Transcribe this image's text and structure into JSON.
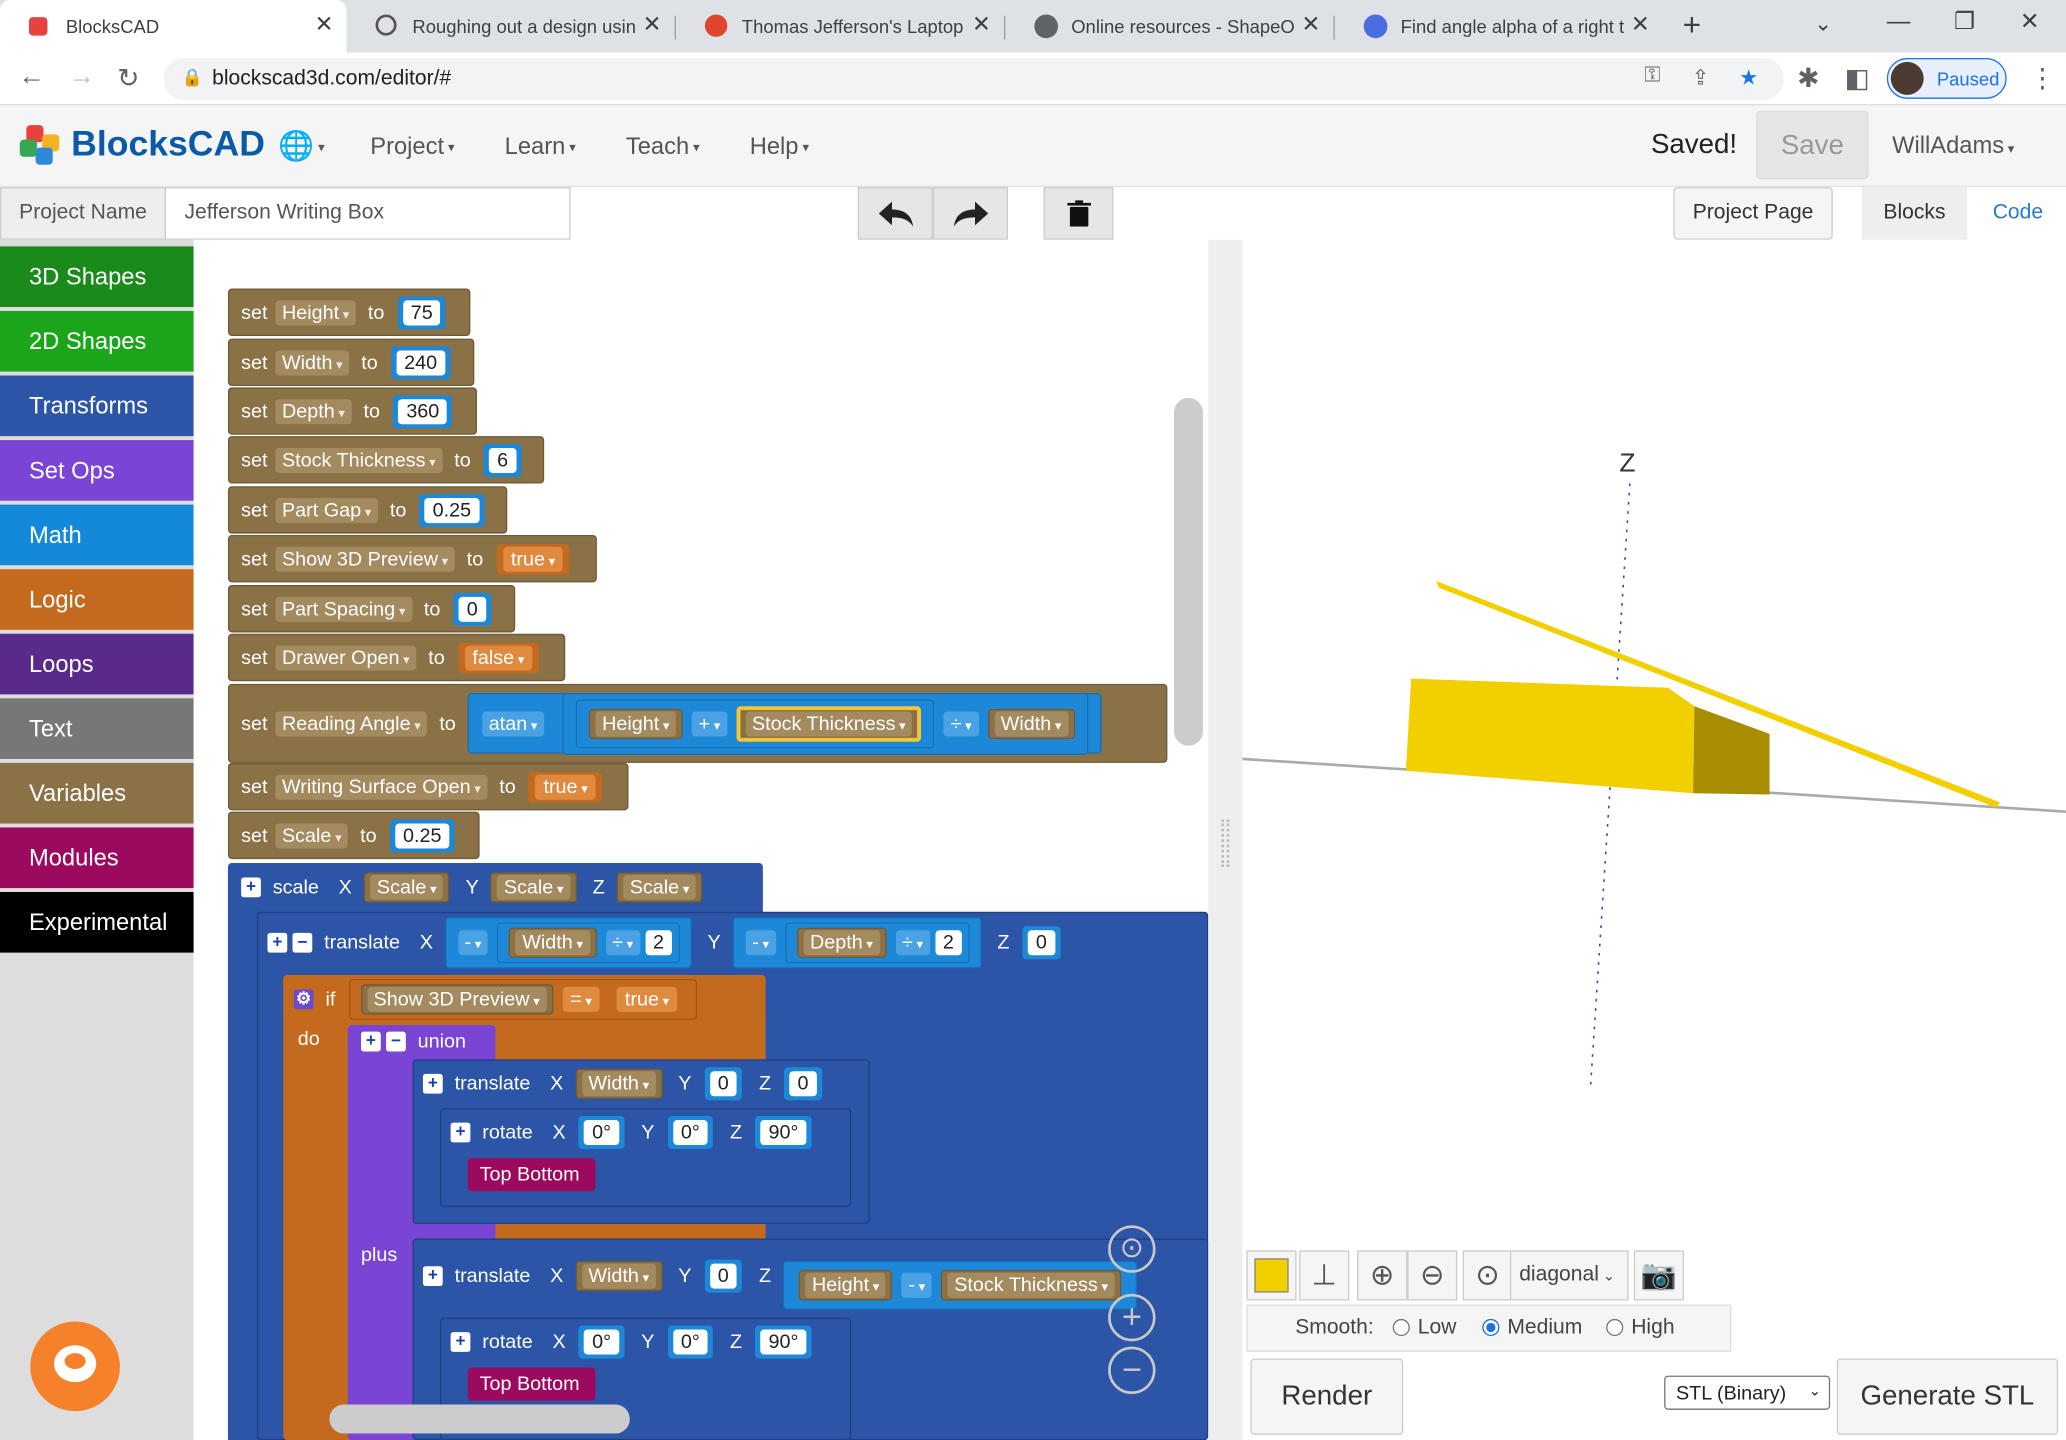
{
  "browser": {
    "tabs": [
      {
        "title": "BlocksCAD",
        "active": true
      },
      {
        "title": "Roughing out a design using",
        "active": false
      },
      {
        "title": "Thomas Jefferson's Laptop W",
        "active": false
      },
      {
        "title": "Online resources - ShapeOko",
        "active": false
      },
      {
        "title": "Find angle alpha of a right tri",
        "active": false
      }
    ],
    "url": "blockscad3d.com/editor/#",
    "profile_status": "Paused"
  },
  "app": {
    "logo_text": "BlocksCAD",
    "menu": [
      "Project",
      "Learn",
      "Teach",
      "Help"
    ],
    "status": "Saved!",
    "save_label": "Save",
    "user": "WillAdams"
  },
  "project": {
    "name_label": "Project Name",
    "name_value": "Jefferson Writing Box",
    "project_page_label": "Project Page",
    "view_tabs": [
      "Blocks",
      "Code"
    ]
  },
  "categories": [
    {
      "label": "3D Shapes",
      "color": "#1a8a1a"
    },
    {
      "label": "2D Shapes",
      "color": "#1aa51a"
    },
    {
      "label": "Transforms",
      "color": "#2c55a7"
    },
    {
      "label": "Set Ops",
      "color": "#7a44d4"
    },
    {
      "label": "Math",
      "color": "#1589d9"
    },
    {
      "label": "Logic",
      "color": "#c46a1f"
    },
    {
      "label": "Loops",
      "color": "#5a2a8a"
    },
    {
      "label": "Text",
      "color": "#777777"
    },
    {
      "label": "Variables",
      "color": "#8b7146"
    },
    {
      "label": "Modules",
      "color": "#9b0a5e"
    },
    {
      "label": "Experimental",
      "color": "#000000"
    }
  ],
  "blocks": {
    "set_kw": "set",
    "to_kw": "to",
    "vars": [
      {
        "name": "Height",
        "value": "75",
        "kind": "num"
      },
      {
        "name": "Width",
        "value": "240",
        "kind": "num"
      },
      {
        "name": "Depth",
        "value": "360",
        "kind": "num"
      },
      {
        "name": "Stock Thickness",
        "value": "6",
        "kind": "num"
      },
      {
        "name": "Part Gap",
        "value": "0.25",
        "kind": "num"
      },
      {
        "name": "Show 3D Preview",
        "value": "true",
        "kind": "bool"
      },
      {
        "name": "Part Spacing",
        "value": "0",
        "kind": "num"
      },
      {
        "name": "Drawer Open",
        "value": "false",
        "kind": "bool"
      }
    ],
    "reading_angle": {
      "name": "Reading Angle",
      "fn": "atan",
      "a": "Height",
      "op1": "+",
      "b": "Stock Thickness",
      "op2": "÷",
      "c": "Width"
    },
    "writing_surface": {
      "name": "Writing Surface Open",
      "value": "true"
    },
    "scale_var": {
      "name": "Scale",
      "value": "0.25"
    },
    "scale_block": {
      "label": "scale",
      "x": "Scale",
      "y": "Scale",
      "z": "Scale"
    },
    "translate1": {
      "label": "translate",
      "xop": "-",
      "xvar": "Width",
      "xdiv": "÷",
      "xnum": "2",
      "yop": "-",
      "yvar": "Depth",
      "ydiv": "÷",
      "ynum": "2",
      "z": "0"
    },
    "if_block": {
      "if": "if",
      "do": "do",
      "var": "Show 3D Preview",
      "op": "=",
      "val": "true"
    },
    "union": {
      "label": "union",
      "plus": "plus"
    },
    "translate2": {
      "label": "translate",
      "x": "Width",
      "y": "0",
      "z": "0"
    },
    "rotate1": {
      "label": "rotate",
      "x": "0°",
      "y": "0°",
      "z": "90°"
    },
    "module1": "Top Bottom",
    "translate3": {
      "label": "translate",
      "x": "Width",
      "y": "0",
      "zvar": "Height",
      "zop": "-",
      "zvar2": "Stock Thickness"
    },
    "rotate2": {
      "label": "rotate",
      "x": "0°",
      "y": "0°",
      "z": "90°"
    },
    "module2": "Top Bottom",
    "axis_labels": {
      "x": "X",
      "y": "Y",
      "z": "Z"
    }
  },
  "viewer": {
    "axis_label": "Z",
    "part_color": "#f2d000",
    "view_mode": "diagonal",
    "smooth_label": "Smooth:",
    "smooth_options": [
      "Low",
      "Medium",
      "High"
    ],
    "smooth_selected": "Medium",
    "render_label": "Render",
    "export_format": "STL (Binary)",
    "generate_label": "Generate STL"
  }
}
